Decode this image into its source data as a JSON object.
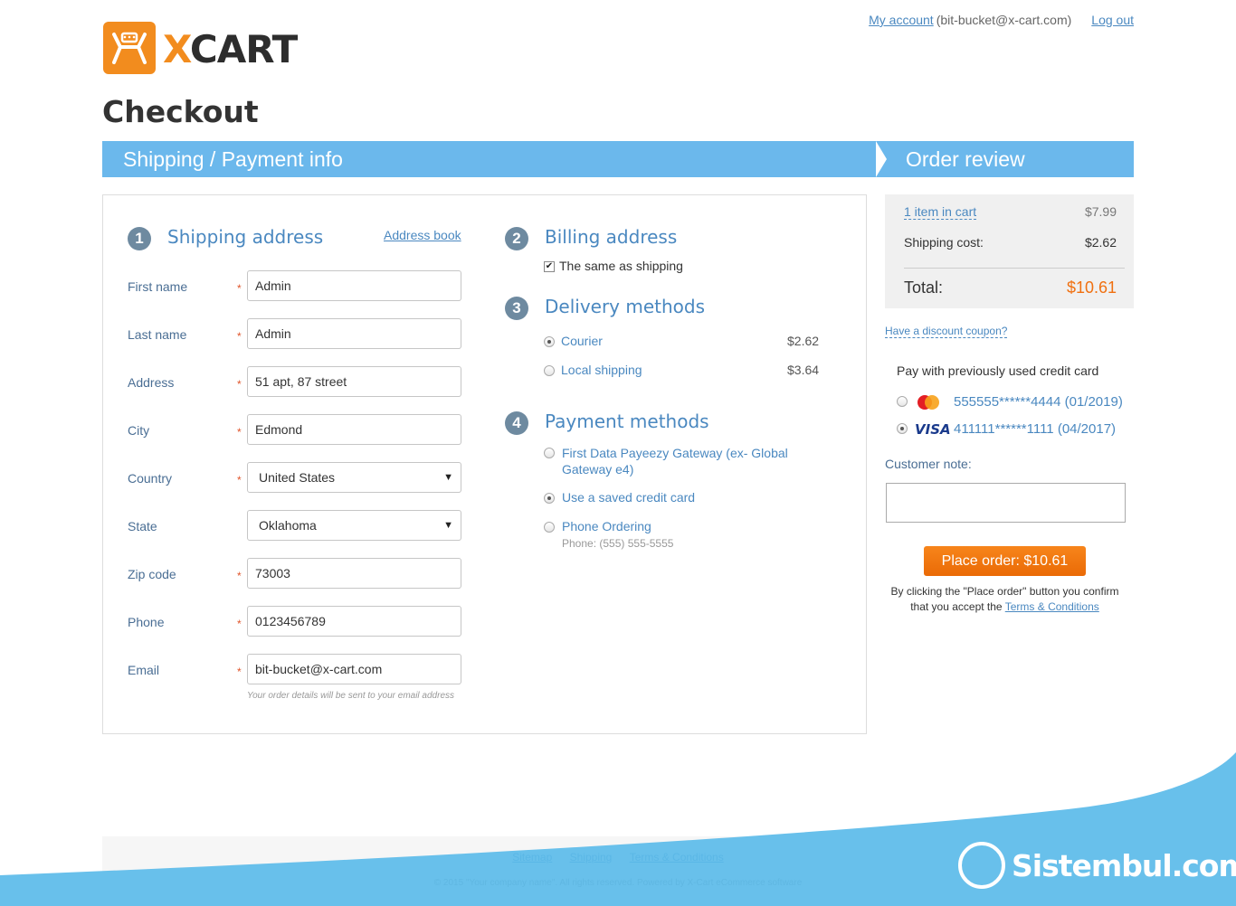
{
  "logo": {
    "x_letter": "X",
    "rest": "CART"
  },
  "topbar": {
    "my_account": "My account",
    "email": "(bit-bucket@x-cart.com)",
    "logout": "Log out"
  },
  "page_title": "Checkout",
  "steps": {
    "step1": "Shipping / Payment info",
    "step2": "Order review"
  },
  "shipping": {
    "number": "1",
    "title": "Shipping address",
    "address_book": "Address book",
    "fields": {
      "first_name": {
        "label": "First name",
        "value": "Admin"
      },
      "last_name": {
        "label": "Last name",
        "value": "Admin"
      },
      "address": {
        "label": "Address",
        "value": "51 apt, 87 street"
      },
      "city": {
        "label": "City",
        "value": "Edmond"
      },
      "country": {
        "label": "Country",
        "value": "United States"
      },
      "state": {
        "label": "State",
        "value": "Oklahoma"
      },
      "zip": {
        "label": "Zip code",
        "value": "73003"
      },
      "phone": {
        "label": "Phone",
        "value": "0123456789"
      },
      "email": {
        "label": "Email",
        "value": "bit-bucket@x-cart.com"
      }
    },
    "required_mark": "*",
    "email_note": "Your order details will be sent to your email address"
  },
  "billing": {
    "number": "2",
    "title": "Billing address",
    "same_as_shipping": "The same as shipping"
  },
  "delivery": {
    "number": "3",
    "title": "Delivery methods",
    "options": [
      {
        "label": "Courier",
        "price": "$2.62",
        "selected": true
      },
      {
        "label": "Local shipping",
        "price": "$3.64",
        "selected": false
      }
    ]
  },
  "payment": {
    "number": "4",
    "title": "Payment methods",
    "options": [
      {
        "label": "First Data Payeezy Gateway (ex- Global Gateway e4)",
        "selected": false
      },
      {
        "label": "Use a saved credit card",
        "selected": true
      },
      {
        "label": "Phone Ordering",
        "note": "Phone: (555) 555-5555",
        "selected": false
      }
    ]
  },
  "summary": {
    "items_link": "1 item in cart",
    "items_price": "$7.99",
    "shipping_label": "Shipping cost:",
    "shipping_price": "$2.62",
    "total_label": "Total:",
    "total_value": "$10.61"
  },
  "coupon": "Have a discount coupon?",
  "saved_cards": {
    "title": "Pay with previously used credit card",
    "cards": [
      {
        "brand": "mastercard-icon",
        "number": "555555******4444 (01/2019)",
        "selected": false
      },
      {
        "brand": "visa-icon",
        "brand_text": "VISA",
        "number": "411111******1111 (04/2017)",
        "selected": true
      }
    ]
  },
  "customer_note": {
    "label": "Customer note:"
  },
  "place_order": "Place order: $10.61",
  "confirm": {
    "text": "By clicking the \"Place order\" button you confirm that you accept the",
    "link": "Terms & Conditions"
  },
  "footer": {
    "links": [
      "Sitemap",
      "Shipping",
      "Terms & Conditions"
    ],
    "copyright": "© 2015 \"Your company name\". All rights reserved. Powered by X-Cart eCommerce software"
  },
  "watermark": "Sistembul.com",
  "colors": {
    "accent_blue": "#6bb8ec",
    "link": "#4a88c0",
    "orange": "#f28c1e",
    "total": "#f07010"
  }
}
